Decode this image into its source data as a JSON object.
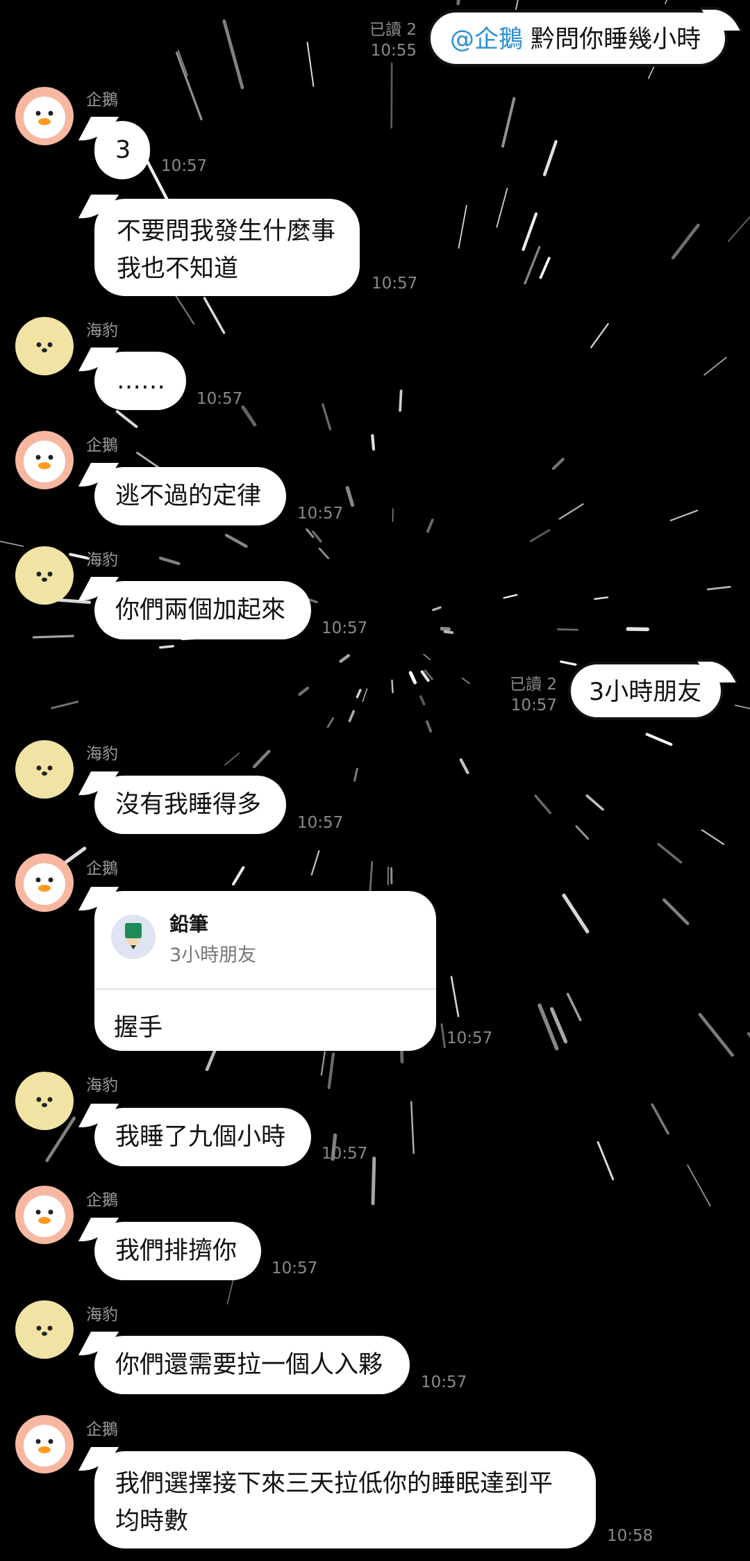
{
  "contacts": {
    "penguin": "企鵝",
    "seal": "海豹"
  },
  "messages": [
    {
      "id": "m1",
      "dir": "out",
      "mention": "@企鵝",
      "text": " 黔問你睡幾小時",
      "read": "已讀 2",
      "time": "10:55"
    },
    {
      "id": "m2",
      "dir": "in",
      "sender": "企鵝",
      "text": "3",
      "time": "10:57"
    },
    {
      "id": "m3",
      "dir": "in",
      "text": "不要問我發生什麼事\n我也不知道",
      "time": "10:57"
    },
    {
      "id": "m4",
      "dir": "in",
      "sender": "海豹",
      "text": "……",
      "time": "10:57"
    },
    {
      "id": "m5",
      "dir": "in",
      "sender": "企鵝",
      "text": "逃不過的定律",
      "time": "10:57"
    },
    {
      "id": "m6",
      "dir": "in",
      "sender": "海豹",
      "text": "你們兩個加起來",
      "time": "10:57"
    },
    {
      "id": "m7",
      "dir": "out",
      "text": "3小時朋友",
      "read": "已讀 2",
      "time": "10:57"
    },
    {
      "id": "m8",
      "dir": "in",
      "sender": "海豹",
      "text": "沒有我睡得多",
      "time": "10:57"
    },
    {
      "id": "m9",
      "dir": "in",
      "sender": "企鵝",
      "card": {
        "name": "鉛筆",
        "sub": "3小時朋友",
        "action": "握手"
      },
      "time": "10:57"
    },
    {
      "id": "m10",
      "dir": "in",
      "sender": "海豹",
      "text": "我睡了九個小時",
      "time": "10:57"
    },
    {
      "id": "m11",
      "dir": "in",
      "sender": "企鵝",
      "text": "我們排擠你",
      "time": "10:57"
    },
    {
      "id": "m12",
      "dir": "in",
      "sender": "海豹",
      "text": "你們還需要拉一個人入夥",
      "time": "10:57"
    },
    {
      "id": "m13",
      "dir": "in",
      "sender": "企鵝",
      "text": "我們選擇接下來三天拉低你的睡眠達到平\n均時數",
      "time": "10:58"
    }
  ],
  "colors": {
    "background": "#000000",
    "bubble": "#ffffff",
    "mention": "#2b8fd6",
    "meta": "#8a8a8a",
    "penguin_avatar": "#f7b7a0",
    "seal_avatar": "#f0e3a4"
  },
  "icons": {
    "penguin_avatar": "penguin-avatar-icon",
    "seal_avatar": "seal-avatar-icon",
    "pencil_avatar": "pencil-avatar-icon"
  }
}
